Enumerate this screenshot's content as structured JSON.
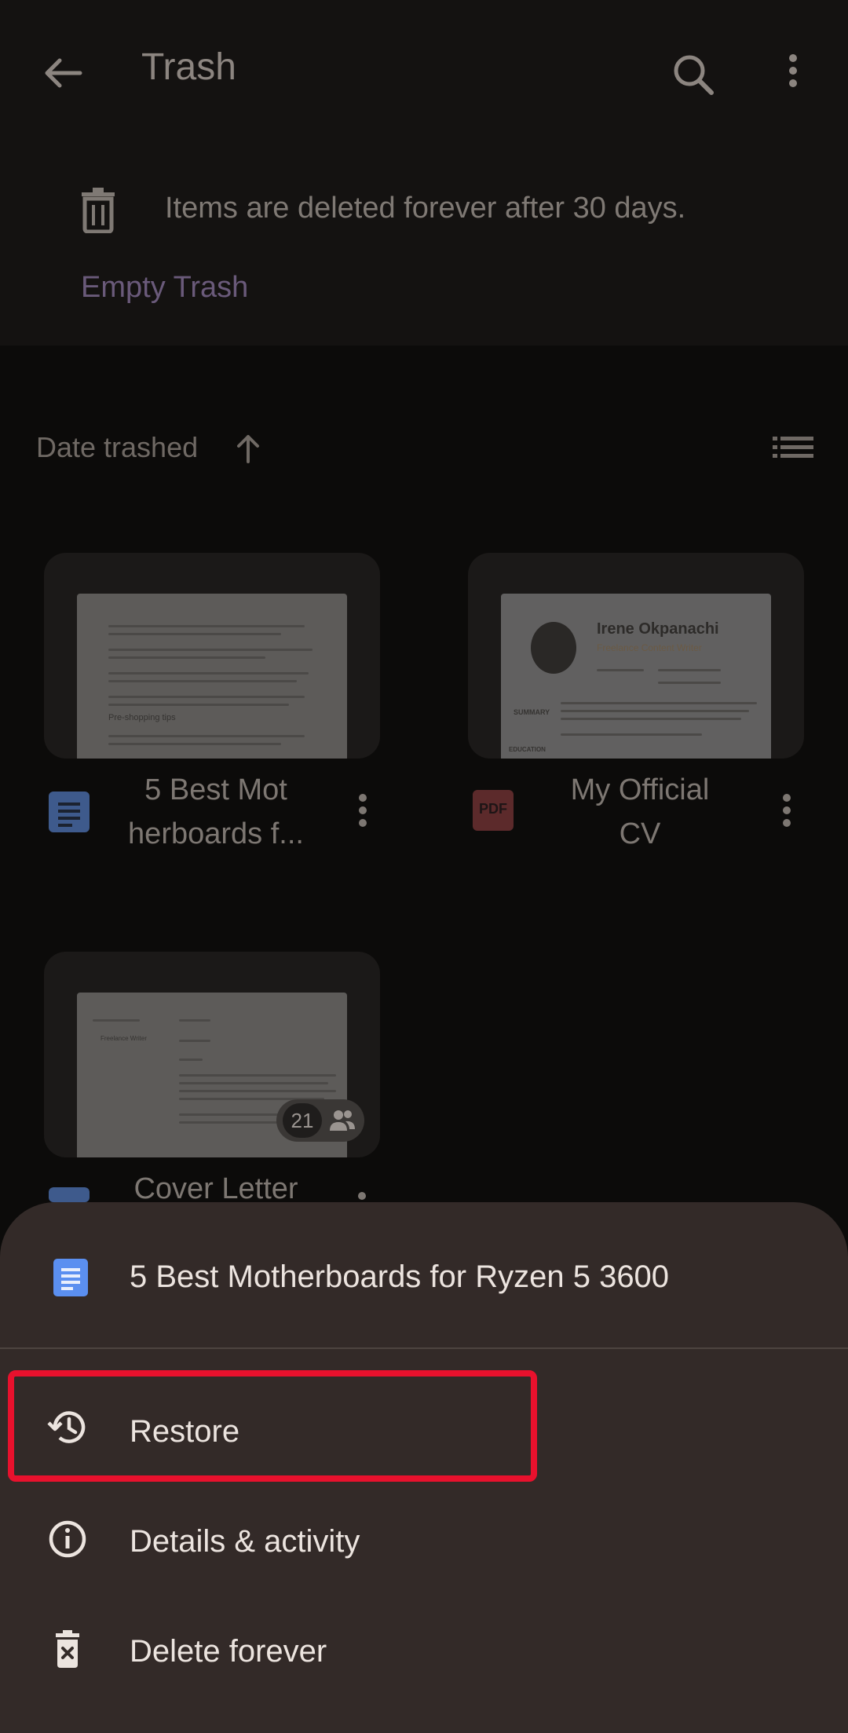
{
  "app_bar": {
    "title": "Trash",
    "back_icon": "arrow-back-icon",
    "search_icon": "search-icon",
    "more_icon": "more-vert-icon"
  },
  "notice": {
    "text": "Items are deleted forever after 30 days.",
    "action": "Empty Trash",
    "icon": "trash-icon"
  },
  "sort": {
    "label": "Date trashed",
    "direction_icon": "arrow-up-icon",
    "view_icon": "list-view-icon"
  },
  "files": [
    {
      "name_line1": "5 Best Mot",
      "name_line2": "herboards f...",
      "type": "doc",
      "icon": "google-docs-icon",
      "preview_heading": "Pre-shopping tips"
    },
    {
      "name_line1": "My Official",
      "name_line2": "CV",
      "type": "pdf",
      "icon": "pdf-icon",
      "icon_label": "PDF",
      "preview_name": "Irene Okpanachi",
      "preview_role": "Freelance Content Writer",
      "preview_section1": "SUMMARY",
      "preview_section2": "EDUCATION"
    },
    {
      "name_line1": "Cover Letter",
      "type": "doc",
      "icon": "google-docs-icon",
      "preview_left": "Freelance Writer",
      "shared_count": "21",
      "shared_icon": "people-icon"
    }
  ],
  "sheet": {
    "title": "5 Best Motherboards for Ryzen 5 3600",
    "items": [
      {
        "label": "Restore",
        "icon": "restore-history-icon"
      },
      {
        "label": "Details & activity",
        "icon": "info-icon"
      },
      {
        "label": "Delete forever",
        "icon": "delete-forever-icon"
      }
    ]
  },
  "colors": {
    "highlight": "#e8112d",
    "docs_blue": "#5b8ff0",
    "pdf_red": "#b5383b",
    "sheet_bg": "#332a28"
  }
}
